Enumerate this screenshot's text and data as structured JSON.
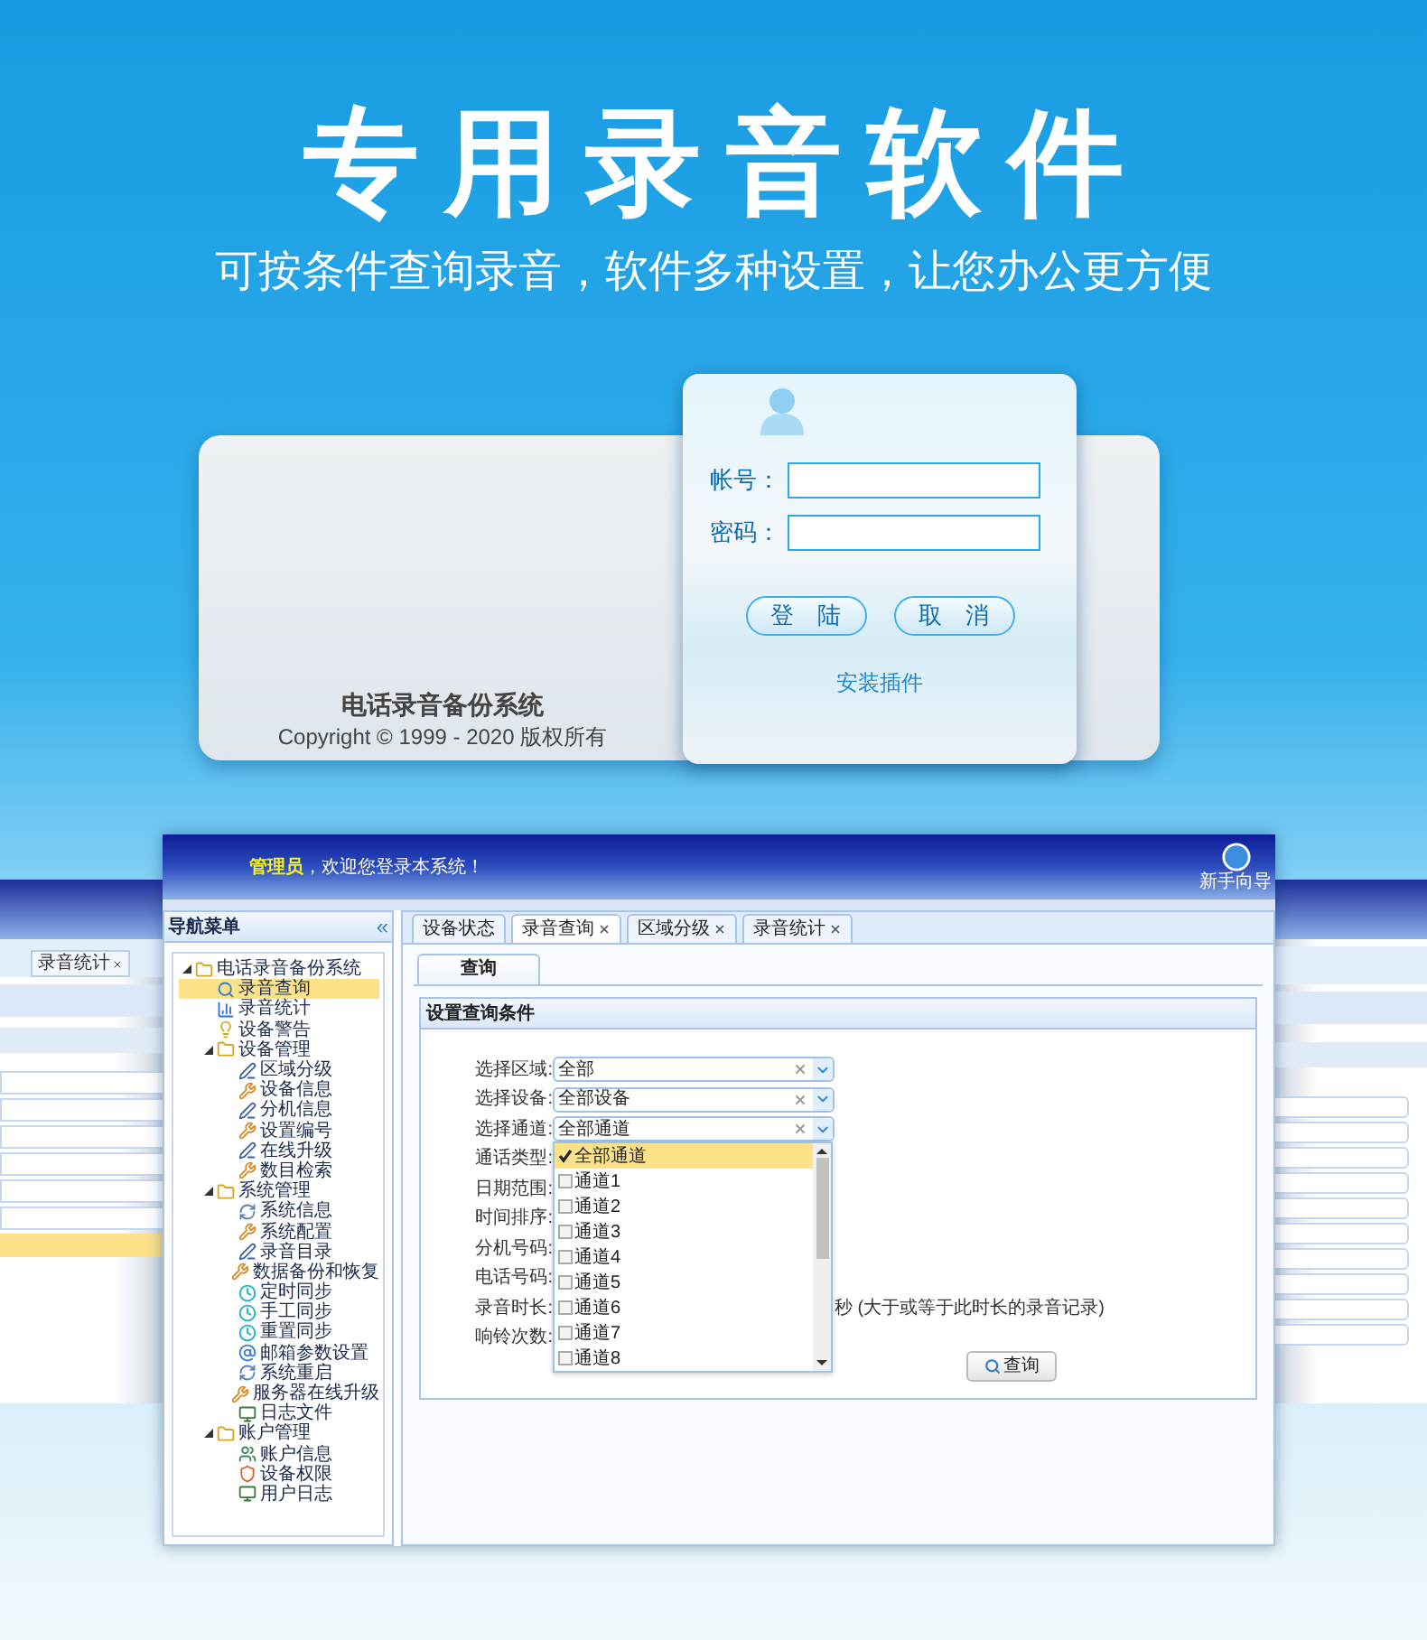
{
  "headline": "专用录音软件",
  "subtitle": "可按条件查询录音，软件多种设置，让您办公更方便",
  "login": {
    "system_name": "电话录音备份系统",
    "copyright": "Copyright © 1999 - 2020 版权所有",
    "fields": [
      {
        "label": "帐号："
      },
      {
        "label": "密码："
      }
    ],
    "buttons": [
      "登　陆",
      "取　消"
    ],
    "link": "安装插件"
  },
  "left_screen": {
    "tab": "录音统计"
  },
  "app": {
    "user": "管理员",
    "welcome": "，欢迎您登录本系统！",
    "guide": "新手向导",
    "nav_title": "导航菜单",
    "collapse": "«",
    "tree": [
      {
        "label": "电话录音备份系统",
        "kind": "folder",
        "expanded": true,
        "selected": false,
        "children": [
          {
            "label": "录音查询",
            "kind": "search",
            "selected": true
          },
          {
            "label": "录音统计",
            "kind": "chart",
            "selected": false
          },
          {
            "label": "设备警告",
            "kind": "bulb",
            "selected": false
          },
          {
            "label": "设备管理",
            "kind": "folder",
            "expanded": true,
            "selected": false,
            "children": [
              {
                "label": "区域分级",
                "kind": "pen",
                "selected": false
              },
              {
                "label": "设备信息",
                "kind": "tools",
                "selected": false
              },
              {
                "label": "分机信息",
                "kind": "pen",
                "selected": false
              },
              {
                "label": "设置编号",
                "kind": "tools",
                "selected": false
              },
              {
                "label": "在线升级",
                "kind": "pen",
                "selected": false
              },
              {
                "label": "数目检索",
                "kind": "tools",
                "selected": false
              }
            ]
          },
          {
            "label": "系统管理",
            "kind": "folder",
            "expanded": true,
            "selected": false,
            "children": [
              {
                "label": "系统信息",
                "kind": "refresh",
                "selected": false
              },
              {
                "label": "系统配置",
                "kind": "tools",
                "selected": false
              },
              {
                "label": "录音目录",
                "kind": "pen",
                "selected": false
              },
              {
                "label": "数据备份和恢复",
                "kind": "tools",
                "selected": false
              },
              {
                "label": "定时同步",
                "kind": "clock",
                "selected": false
              },
              {
                "label": "手工同步",
                "kind": "clock",
                "selected": false
              },
              {
                "label": "重置同步",
                "kind": "clock",
                "selected": false
              },
              {
                "label": "邮箱参数设置",
                "kind": "mail",
                "selected": false
              },
              {
                "label": "系统重启",
                "kind": "refresh",
                "selected": false
              },
              {
                "label": "服务器在线升级",
                "kind": "tools",
                "selected": false
              },
              {
                "label": "日志文件",
                "kind": "monitor",
                "selected": false
              }
            ]
          },
          {
            "label": "账户管理",
            "kind": "folder",
            "expanded": true,
            "selected": false,
            "children": [
              {
                "label": "账户信息",
                "kind": "user",
                "selected": false
              },
              {
                "label": "设备权限",
                "kind": "shield",
                "selected": false
              },
              {
                "label": "用户日志",
                "kind": "monitor",
                "selected": false
              }
            ]
          }
        ]
      }
    ],
    "tabs": [
      {
        "label": "设备状态",
        "closable": false,
        "selected": false
      },
      {
        "label": "录音查询",
        "closable": true,
        "selected": true
      },
      {
        "label": "区域分级",
        "closable": true,
        "selected": false
      },
      {
        "label": "录音统计",
        "closable": true,
        "selected": false
      }
    ],
    "subtab": "查询",
    "panel_title": "设置查询条件",
    "form": [
      {
        "label": "选择区域:",
        "value": "全部"
      },
      {
        "label": "选择设备:",
        "value": "全部设备"
      },
      {
        "label": "选择通道:",
        "value": "全部通道"
      },
      {
        "label": "通话类型:"
      },
      {
        "label": "日期范围:"
      },
      {
        "label": "时间排序:"
      },
      {
        "label": "分机号码:"
      },
      {
        "label": "电话号码:"
      },
      {
        "label": "录音时长:",
        "note": "秒 (大于或等于此时长的录音记录)"
      },
      {
        "label": "响铃次数:"
      }
    ],
    "dropdown": [
      {
        "label": "全部通道",
        "checked": true,
        "selected": true
      },
      {
        "label": "通道1",
        "checked": false,
        "selected": false
      },
      {
        "label": "通道2",
        "checked": false,
        "selected": false
      },
      {
        "label": "通道3",
        "checked": false,
        "selected": false
      },
      {
        "label": "通道4",
        "checked": false,
        "selected": false
      },
      {
        "label": "通道5",
        "checked": false,
        "selected": false
      },
      {
        "label": "通道6",
        "checked": false,
        "selected": false
      },
      {
        "label": "通道7",
        "checked": false,
        "selected": false
      },
      {
        "label": "通道8",
        "checked": false,
        "selected": false
      }
    ],
    "search_button": "查询"
  }
}
